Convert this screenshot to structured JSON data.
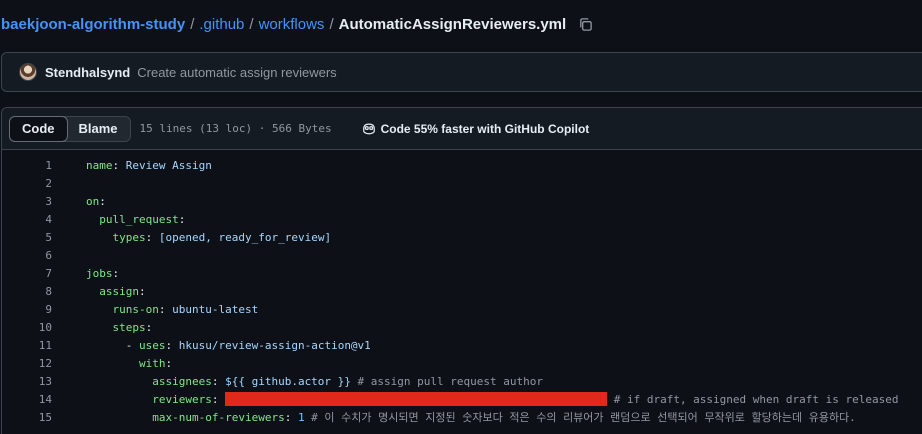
{
  "breadcrumb": {
    "repo": "baekjoon-algorithm-study",
    "sep": "/",
    "folder1": ".github",
    "folder2": "workflows",
    "file": "AutomaticAssignReviewers.yml"
  },
  "commit": {
    "author": "Stendhalsynd",
    "message": "Create automatic assign reviewers"
  },
  "file_header": {
    "tab_code": "Code",
    "tab_blame": "Blame",
    "info": "15 lines (13 loc) · 566 Bytes",
    "copilot": "Code 55% faster with GitHub Copilot"
  },
  "code": {
    "l1": {
      "num": "1",
      "key": "name",
      "colon": ": ",
      "val": "Review Assign"
    },
    "l2": {
      "num": "2"
    },
    "l3": {
      "num": "3",
      "key": "on",
      "colon": ":"
    },
    "l4": {
      "num": "4",
      "indent": "  ",
      "key": "pull_request",
      "colon": ":"
    },
    "l5": {
      "num": "5",
      "indent": "    ",
      "key": "types",
      "colon": ": ",
      "val": "[opened, ready_for_review]"
    },
    "l6": {
      "num": "6"
    },
    "l7": {
      "num": "7",
      "key": "jobs",
      "colon": ":"
    },
    "l8": {
      "num": "8",
      "indent": "  ",
      "key": "assign",
      "colon": ":"
    },
    "l9": {
      "num": "9",
      "indent": "    ",
      "key": "runs-on",
      "colon": ": ",
      "val": "ubuntu-latest"
    },
    "l10": {
      "num": "10",
      "indent": "    ",
      "key": "steps",
      "colon": ":"
    },
    "l11": {
      "num": "11",
      "indent": "      ",
      "dash": "- ",
      "key": "uses",
      "colon": ": ",
      "val": "hkusu/review-assign-action@v1"
    },
    "l12": {
      "num": "12",
      "indent": "        ",
      "key": "with",
      "colon": ":"
    },
    "l13": {
      "num": "13",
      "indent": "          ",
      "key": "assignees",
      "colon": ": ",
      "val": "${{ github.actor }}",
      "comment": " # assign pull request author"
    },
    "l14": {
      "num": "14",
      "indent": "          ",
      "key": "reviewers",
      "colon": ": ",
      "comment": " # if draft, assigned when draft is released"
    },
    "l15": {
      "num": "15",
      "indent": "          ",
      "key": "max-num-of-reviewers",
      "colon": ": ",
      "val": "1",
      "comment": " # 이 수치가 명시되면 지정된 숫자보다 적은 수의 리뷰어가 랜덤으로 선택되어 무작위로 할당하는데 유용하다."
    }
  },
  "colors": {
    "link": "#4493f8",
    "key": "#7ee787",
    "string": "#a5d6ff",
    "comment": "#9198a1",
    "redaction": "#e0281b"
  },
  "icons": [
    "copy-icon",
    "avatar",
    "copilot-icon"
  ]
}
